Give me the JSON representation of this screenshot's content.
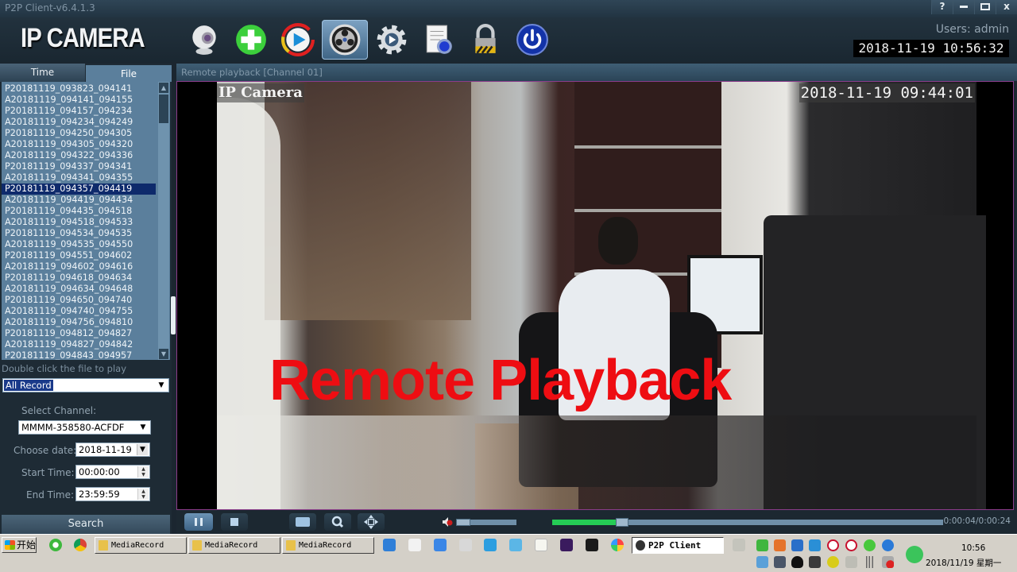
{
  "window": {
    "title": "P2P Client-v6.4.1.3",
    "buttons": [
      {
        "name": "help-button",
        "label": "?"
      },
      {
        "name": "minimize-button",
        "label": "▬"
      },
      {
        "name": "maximize-button",
        "label": "▭"
      },
      {
        "name": "close-button",
        "label": "x"
      }
    ]
  },
  "header": {
    "logo": "IP CAMERA",
    "users_label": "Users: admin",
    "clock": "2018-11-19 10:56:32",
    "toolbar": [
      {
        "name": "live-view-button",
        "icon": "webcam-icon"
      },
      {
        "name": "add-device-button",
        "icon": "plus-icon"
      },
      {
        "name": "playback-button",
        "icon": "play-circle-icon"
      },
      {
        "name": "remote-playback-button",
        "icon": "film-reel-icon",
        "active": true
      },
      {
        "name": "settings-button",
        "icon": "gear-icon"
      },
      {
        "name": "log-button",
        "icon": "document-gear-icon"
      },
      {
        "name": "lock-button",
        "icon": "lock-icon"
      },
      {
        "name": "exit-button",
        "icon": "power-icon"
      }
    ]
  },
  "left_panel": {
    "tabs": [
      {
        "label": "Time",
        "active": false
      },
      {
        "label": "File",
        "active": true
      }
    ],
    "files": [
      "P20181119_093823_094141",
      "A20181119_094141_094155",
      "P20181119_094157_094234",
      "A20181119_094234_094249",
      "P20181119_094250_094305",
      "A20181119_094305_094320",
      "A20181119_094322_094336",
      "P20181119_094337_094341",
      "A20181119_094341_094355",
      "P20181119_094357_094419",
      "A20181119_094419_094434",
      "P20181119_094435_094518",
      "A20181119_094518_094533",
      "P20181119_094534_094535",
      "A20181119_094535_094550",
      "P20181119_094551_094602",
      "A20181119_094602_094616",
      "P20181119_094618_094634",
      "A20181119_094634_094648",
      "P20181119_094650_094740",
      "A20181119_094740_094755",
      "A20181119_094756_094810",
      "P20181119_094812_094827",
      "A20181119_094827_094842",
      "P20181119_094843_094957"
    ],
    "selected_file_index": 9,
    "hint": "Double click the file to play",
    "record_type": "All Record",
    "channel_label": "Select Channel:",
    "channel_value": "MMMM-358580-ACFDF",
    "date_label": "Choose date:",
    "date_value": "2018-11-19",
    "start_label": "Start Time:",
    "start_value": "00:00:00",
    "end_label": "End Time:",
    "end_value": "23:59:59",
    "search_label": "Search"
  },
  "viewer": {
    "title": "Remote playback [Channel 01]",
    "osd_name": "IP Camera",
    "osd_time": "2018-11-19 09:44:01",
    "overlay_text": "Remote Playback"
  },
  "controls": {
    "buttons": [
      {
        "name": "pause-button",
        "icon": "pause-icon"
      },
      {
        "name": "stop-button",
        "icon": "stop-icon"
      },
      {
        "name": "snapshot-button",
        "icon": "camera-icon"
      },
      {
        "name": "zoom-button",
        "icon": "zoom-in-icon"
      },
      {
        "name": "ptz-button",
        "icon": "move-arrows-icon"
      }
    ],
    "volume_percent": 0,
    "muted": true,
    "progress_fraction": 0.167,
    "timecode": "0:00:04/0:00:24",
    "colors": {
      "progress": "#25cc55",
      "overlay": "#ee0d12"
    }
  },
  "taskbar": {
    "start_label": "开始",
    "tasks": [
      {
        "label": "MediaRecord",
        "active": false
      },
      {
        "label": "MediaRecord",
        "active": false
      },
      {
        "label": "MediaRecord",
        "active": false
      },
      {
        "label": "P2P Client",
        "active": true
      }
    ],
    "clock_time": "10:56",
    "clock_date": "2018/11/19 星期一"
  }
}
